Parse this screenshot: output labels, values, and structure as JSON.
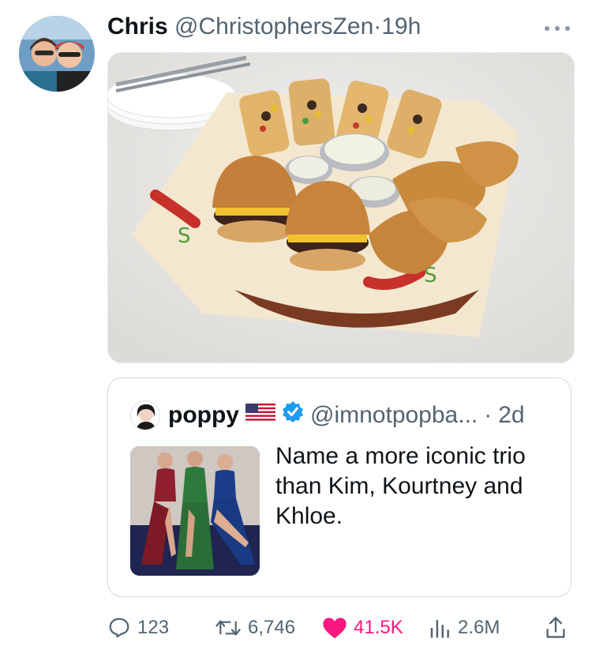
{
  "tweet": {
    "author_name": "Chris",
    "author_handle": "@ChristophersZen",
    "separator": "·",
    "time": "19h",
    "more_icon": "more-horizontal-icon"
  },
  "quoted": {
    "author_name": "poppy",
    "flag_icon": "us-flag-icon",
    "verified_icon": "verified-badge-icon",
    "author_handle": "@imnotpopba...",
    "separator": "·",
    "time": "2d",
    "text": "Name a more iconic trio than Kim, Kourtney and Khloe."
  },
  "actions": {
    "replies": "123",
    "reposts": "6,746",
    "likes": "41.5K",
    "views": "2.6M"
  },
  "colors": {
    "like_pink": "#f91880",
    "meta_gray": "#536471",
    "verified_blue": "#1d9bf0"
  }
}
